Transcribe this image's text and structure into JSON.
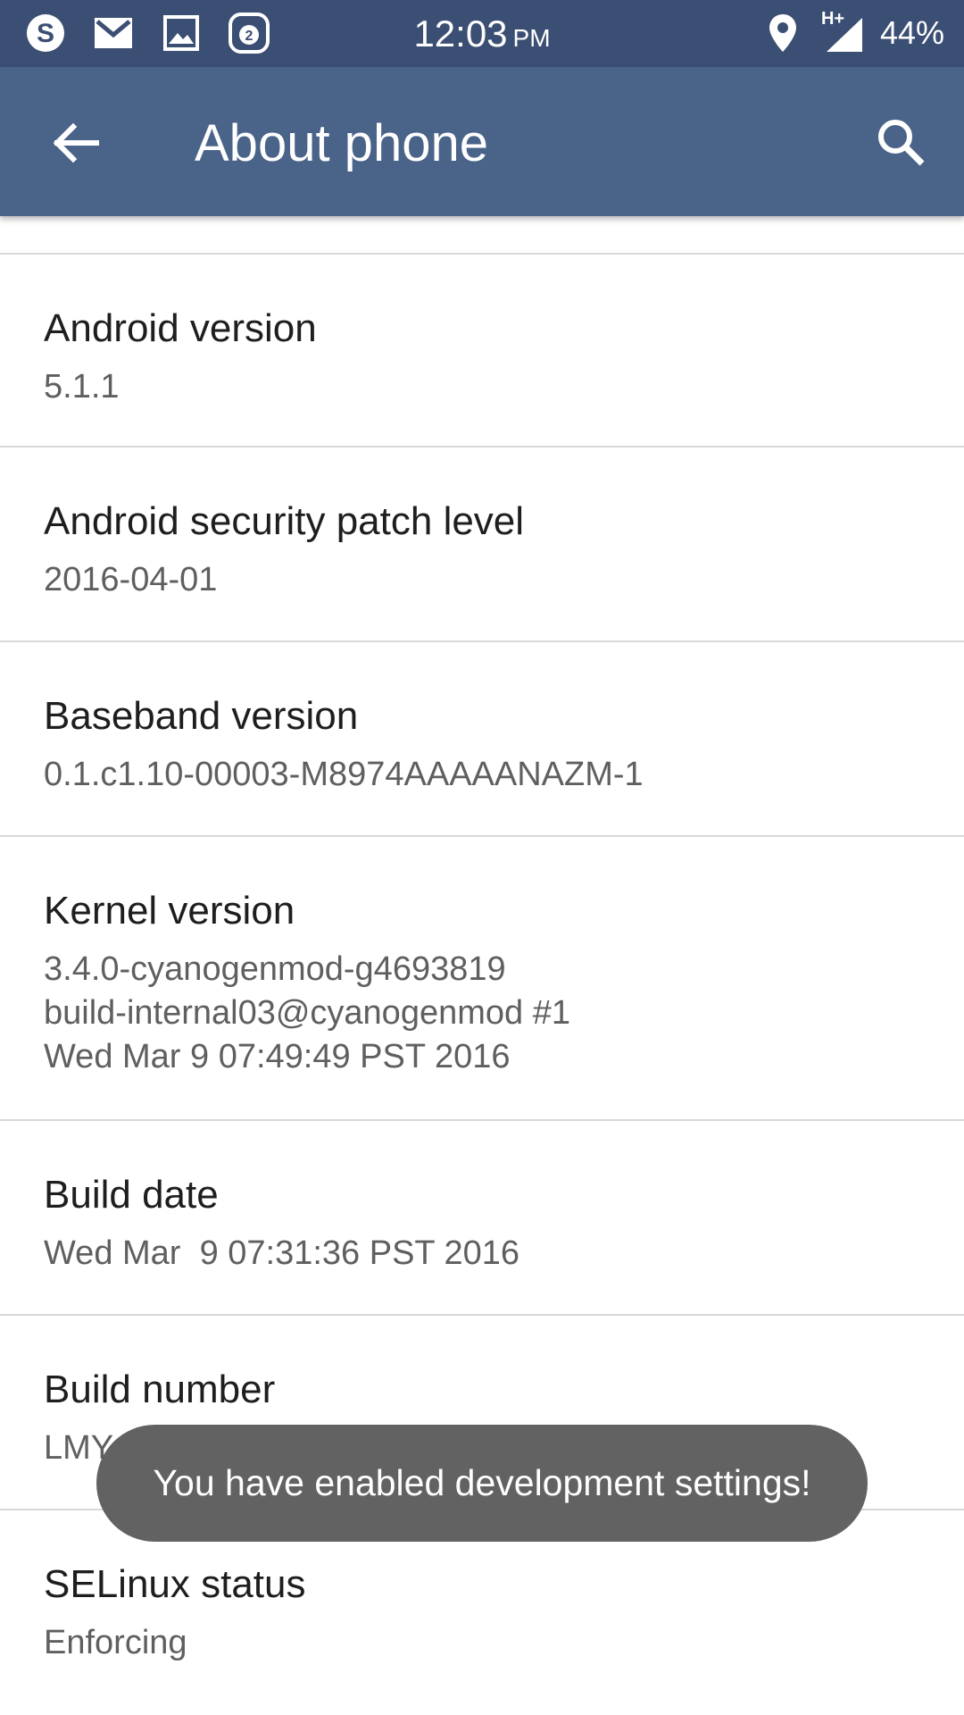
{
  "status_bar": {
    "time": "12:03",
    "ampm": "PM",
    "battery": "44%",
    "network": "H+",
    "icons": [
      "skype-icon",
      "gmail-icon",
      "gallery-icon",
      "notification-count-icon",
      "location-icon",
      "signal-icon"
    ],
    "notification_count": "2"
  },
  "app_bar": {
    "title": "About phone",
    "back_icon": "arrow-back-icon",
    "search_icon": "search-icon"
  },
  "items": [
    {
      "title": "Android version",
      "value": "5.1.1"
    },
    {
      "title": "Android security patch level",
      "value": "2016-04-01"
    },
    {
      "title": "Baseband version",
      "value": "0.1.c1.10-00003-M8974AAAAANAZM-1"
    },
    {
      "title": "Kernel version",
      "value": "3.4.0-cyanogenmod-g4693819\nbuild-internal03@cyanogenmod #1\nWed Mar 9 07:49:49 PST 2016"
    },
    {
      "title": "Build date",
      "value": "Wed Mar  9 07:31:36 PST 2016"
    },
    {
      "title": "Build number",
      "value": "LMY49H"
    },
    {
      "title": "SELinux status",
      "value": "Enforcing"
    }
  ],
  "toast": "You have enabled development settings!",
  "colors": {
    "status_bar": "#3b4e73",
    "app_bar": "#4a6389",
    "toast": "#626262"
  }
}
